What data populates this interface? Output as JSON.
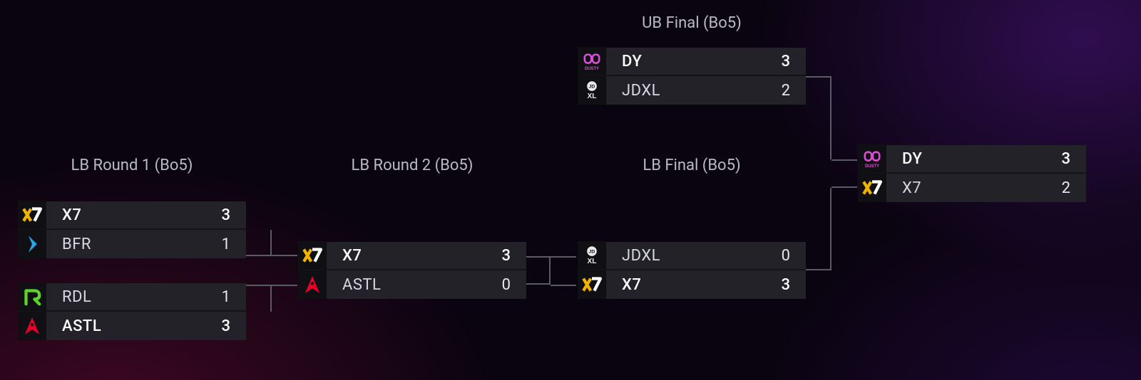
{
  "rounds": {
    "ub_final": "UB Final (Bo5)",
    "lb_r1": "LB Round 1 (Bo5)",
    "lb_r2": "LB Round 2 (Bo5)",
    "lb_final": "LB Final (Bo5)"
  },
  "teams": {
    "X7": {
      "name": "X7",
      "icon": "x7-icon"
    },
    "BFR": {
      "name": "BFR",
      "icon": "bfr-icon"
    },
    "RDL": {
      "name": "RDL",
      "icon": "rdl-icon"
    },
    "ASTL": {
      "name": "ASTL",
      "icon": "astralis-icon"
    },
    "DY": {
      "name": "DY",
      "icon": "dusty-icon"
    },
    "JDXL": {
      "name": "JDXL",
      "icon": "jdxl-icon"
    }
  },
  "matches": {
    "ub_final": {
      "top": {
        "team": "DY",
        "score": 3,
        "winner": true
      },
      "bot": {
        "team": "JDXL",
        "score": 2,
        "winner": false
      }
    },
    "lb_r1_a": {
      "top": {
        "team": "X7",
        "score": 3,
        "winner": true
      },
      "bot": {
        "team": "BFR",
        "score": 1,
        "winner": false
      }
    },
    "lb_r1_b": {
      "top": {
        "team": "RDL",
        "score": 1,
        "winner": false
      },
      "bot": {
        "team": "ASTL",
        "score": 3,
        "winner": true
      }
    },
    "lb_r2": {
      "top": {
        "team": "X7",
        "score": 3,
        "winner": true
      },
      "bot": {
        "team": "ASTL",
        "score": 0,
        "winner": false
      }
    },
    "lb_final": {
      "top": {
        "team": "JDXL",
        "score": 0,
        "winner": false
      },
      "bot": {
        "team": "X7",
        "score": 3,
        "winner": true
      }
    },
    "gf": {
      "top": {
        "team": "DY",
        "score": 3,
        "winner": true
      },
      "bot": {
        "team": "X7",
        "score": 2,
        "winner": false
      }
    }
  },
  "colors": {
    "x7_accent": "#f2b200",
    "bfr_accent": "#25a6e6",
    "rdl_accent": "#5fd22e",
    "astl_accent": "#e4002b",
    "dusty_accent": "#d94fd3",
    "jdxl_dark": "#111111"
  }
}
